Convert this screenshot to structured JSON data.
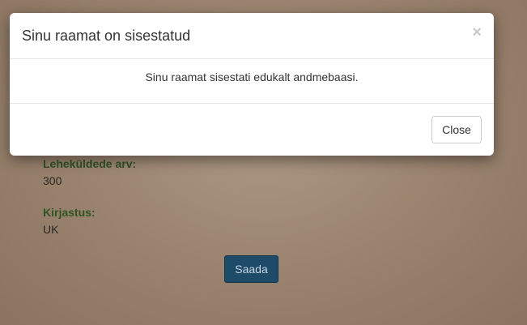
{
  "form": {
    "pages_label": "Leheküldede arv:",
    "pages_value": "300",
    "publisher_label": "Kirjastus:",
    "publisher_value": "UK",
    "submit_label": "Saada"
  },
  "modal": {
    "title": "Sinu raamat on sisestatud",
    "close_icon": "×",
    "message": "Sinu raamat sisestati edukalt andmebaasi.",
    "close_button_label": "Close"
  },
  "colors": {
    "label_green": "#2f5324",
    "submit_blue": "#1d4b68"
  }
}
